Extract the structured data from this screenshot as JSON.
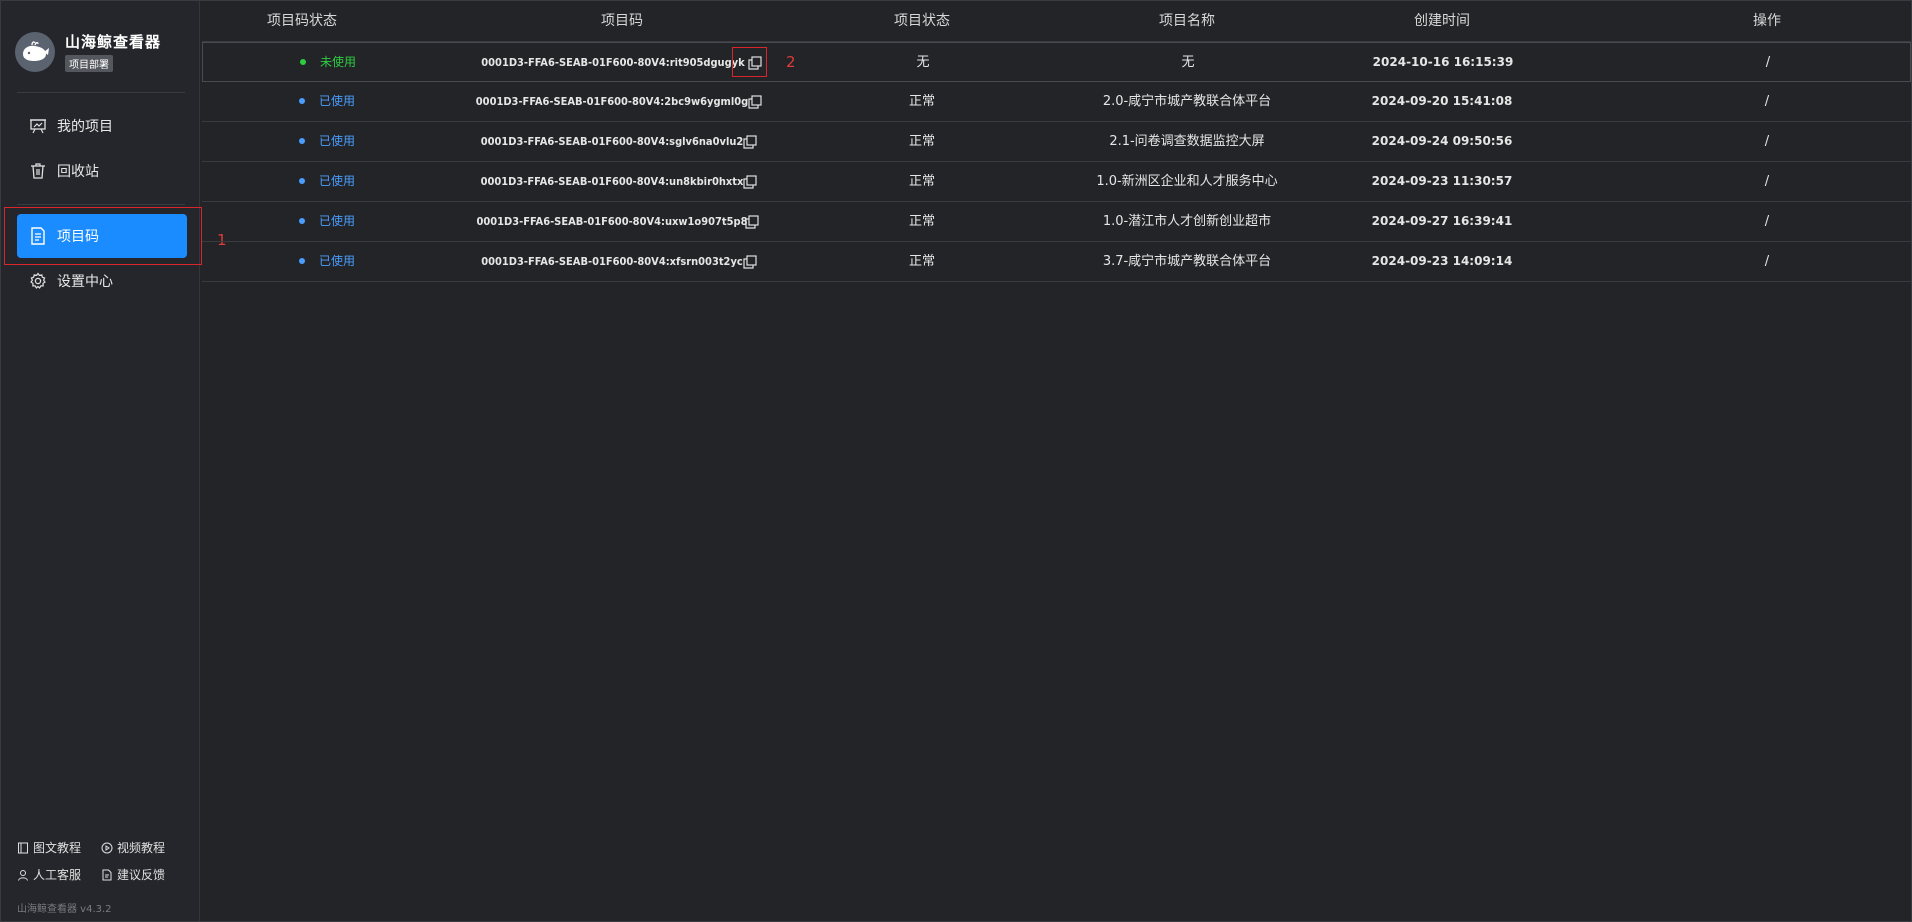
{
  "brand": {
    "title": "山海鲸查看器",
    "tag": "项目部署",
    "version": "山海鲸查看器 v4.3.2"
  },
  "sidebar": {
    "items": [
      {
        "label": "我的项目",
        "icon": "presentation-board-icon"
      },
      {
        "label": "回收站",
        "icon": "trash-icon"
      },
      {
        "label": "项目码",
        "icon": "document-icon",
        "active": true
      },
      {
        "label": "设置中心",
        "icon": "gear-icon"
      }
    ],
    "footer": [
      {
        "label": "图文教程",
        "icon": "book-icon"
      },
      {
        "label": "视频教程",
        "icon": "play-circle-icon"
      },
      {
        "label": "人工客服",
        "icon": "user-icon"
      },
      {
        "label": "建议反馈",
        "icon": "feedback-file-icon"
      }
    ]
  },
  "annotations": {
    "one": "1",
    "two": "2"
  },
  "table": {
    "headers": [
      "项目码状态",
      "项目码",
      "项目状态",
      "项目名称",
      "创建时间",
      "操作"
    ],
    "rows": [
      {
        "code_status": "未使用",
        "code": "0001D3-FFA6-SEAB-01F600-80V4:rit905dgugyk",
        "project_status": "无",
        "name": "无",
        "created": "2024-10-16 16:15:39",
        "action": "/"
      },
      {
        "code_status": "已使用",
        "code": "0001D3-FFA6-SEAB-01F600-80V4:2bc9w6ygml0g",
        "project_status": "正常",
        "name": "2.0-咸宁市城产教联合体平台",
        "created": "2024-09-20 15:41:08",
        "action": "/"
      },
      {
        "code_status": "已使用",
        "code": "0001D3-FFA6-SEAB-01F600-80V4:sglv6na0vlu2",
        "project_status": "正常",
        "name": "2.1-问卷调查数据监控大屏",
        "created": "2024-09-24 09:50:56",
        "action": "/"
      },
      {
        "code_status": "已使用",
        "code": "0001D3-FFA6-SEAB-01F600-80V4:un8kbir0hxtx",
        "project_status": "正常",
        "name": "1.0-新洲区企业和人才服务中心",
        "created": "2024-09-23 11:30:57",
        "action": "/"
      },
      {
        "code_status": "已使用",
        "code": "0001D3-FFA6-SEAB-01F600-80V4:uxw1o907t5p8",
        "project_status": "正常",
        "name": "1.0-潜江市人才创新创业超市",
        "created": "2024-09-27 16:39:41",
        "action": "/"
      },
      {
        "code_status": "已使用",
        "code": "0001D3-FFA6-SEAB-01F600-80V4:xfsrn003t2yc",
        "project_status": "正常",
        "name": "3.7-咸宁市城产教联合体平台",
        "created": "2024-09-23 14:09:14",
        "action": "/"
      }
    ]
  },
  "colors": {
    "accent": "#1b8cff",
    "unused": "#2ecc40",
    "used": "#4a9eff",
    "annotation": "#d8262d"
  }
}
